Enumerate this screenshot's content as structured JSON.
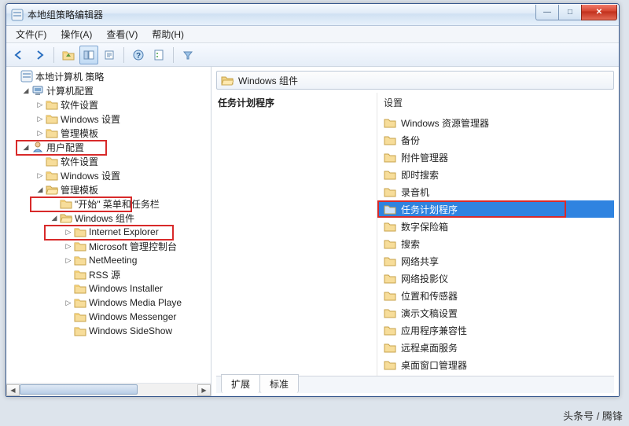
{
  "window": {
    "title": "本地组策略编辑器",
    "buttons": {
      "min": "—",
      "max": "□",
      "close": "✕"
    }
  },
  "menu": {
    "file": "文件(F)",
    "action": "操作(A)",
    "view": "查看(V)",
    "help": "帮助(H)"
  },
  "tree": {
    "root": "本地计算机 策略",
    "computer_cfg": "计算机配置",
    "cc_software": "软件设置",
    "cc_windows": "Windows 设置",
    "cc_admin_tpl": "管理模板",
    "user_cfg": "用户配置",
    "uc_software": "软件设置",
    "uc_windows": "Windows 设置",
    "uc_admin_tpl": "管理模板",
    "start_menu": "\"开始\" 菜单和任务栏",
    "win_comp": "Windows 组件",
    "ie": "Internet Explorer",
    "mmc": "Microsoft 管理控制台",
    "netmeeting": "NetMeeting",
    "rss": "RSS 源",
    "wininst": "Windows Installer",
    "wmp": "Windows Media Playe",
    "wmsg": "Windows Messenger",
    "wside": "Windows SideShow"
  },
  "crumb": {
    "text": "Windows 组件"
  },
  "rl_head": "任务计划程序",
  "rr_head": "设置",
  "items": [
    "Windows 资源管理器",
    "备份",
    "附件管理器",
    "即时搜索",
    "录音机",
    "任务计划程序",
    "数字保险箱",
    "搜索",
    "网络共享",
    "网络投影仪",
    "位置和传感器",
    "演示文稿设置",
    "应用程序兼容性",
    "远程桌面服务",
    "桌面窗口管理器"
  ],
  "selected_index": 5,
  "tabs": {
    "ext": "扩展",
    "std": "标准"
  },
  "footer": "头条号 / 腾锋"
}
